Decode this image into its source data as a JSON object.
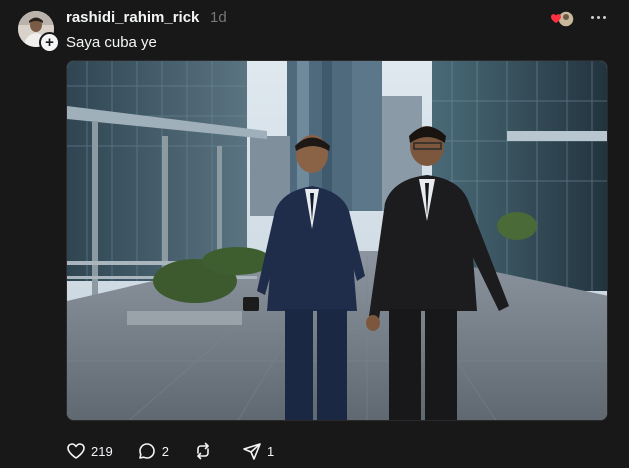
{
  "post": {
    "author": {
      "username": "rashidi_rahim_rick",
      "avatar_icon": "user-avatar"
    },
    "follow_badge_icon": "plus-icon",
    "timestamp": "1d",
    "caption": "Saya cuba ye",
    "image_alt": "Two men in dark business suits walking on a plaza between glass office towers",
    "actions": {
      "likes": "219",
      "comments": "2",
      "reposts": "",
      "shares": "1"
    },
    "like_color": "#ff3040"
  }
}
